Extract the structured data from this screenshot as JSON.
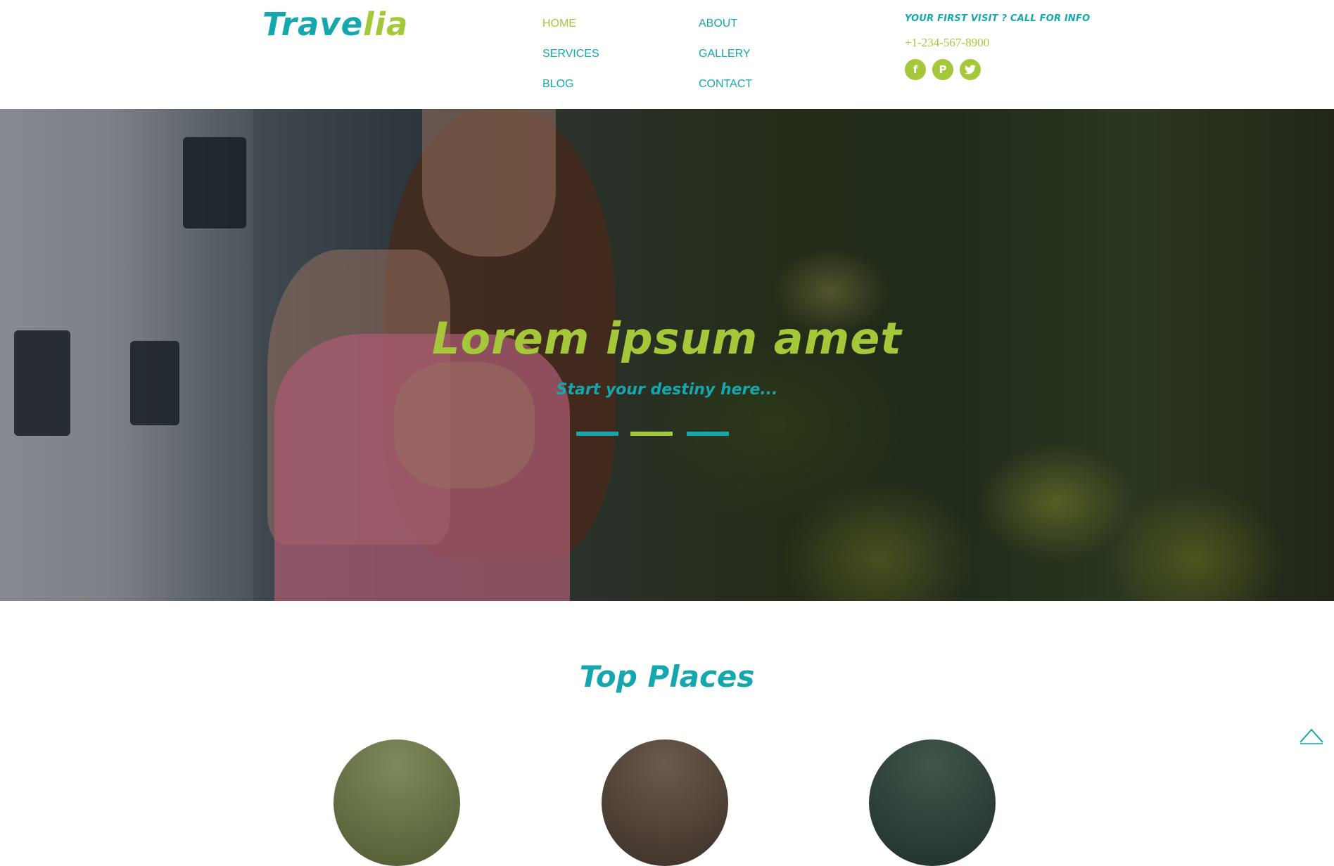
{
  "brand": {
    "part1": "Trave",
    "part2": "lia"
  },
  "nav": {
    "home": "HOME",
    "about": "ABOUT",
    "services": "SERVICES",
    "gallery": "GALLERY",
    "blog": "BLOG",
    "contact": "CONTACT",
    "active": "home"
  },
  "info": {
    "heading": "YOUR FIRST VISIT ? CALL FOR INFO",
    "phone": "+1-234-567-8900"
  },
  "social": [
    {
      "icon": "facebook-icon",
      "glyph": "f"
    },
    {
      "icon": "pinterest-icon",
      "glyph": "P"
    },
    {
      "icon": "twitter-icon",
      "glyph": "t"
    }
  ],
  "hero": {
    "title": "Lorem ipsum amet",
    "subtitle": "Start your destiny here..."
  },
  "section": {
    "title": "Top Places"
  },
  "colors": {
    "teal": "#14a8ae",
    "lime": "#a5c73a"
  },
  "back_to_top_icon": "chevron-up-icon"
}
